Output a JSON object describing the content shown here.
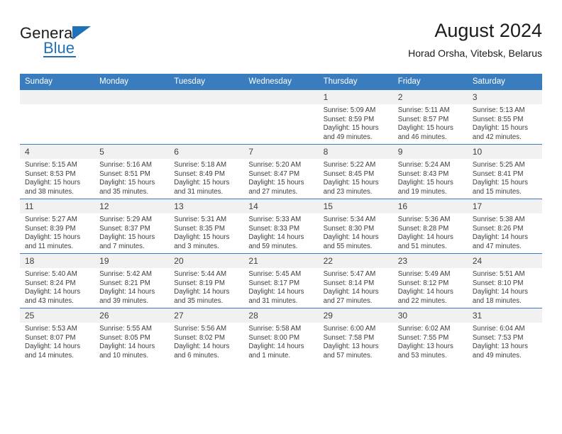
{
  "brand": {
    "name_top": "General",
    "name_bottom": "Blue",
    "accent_color": "#2072b8"
  },
  "header": {
    "title": "August 2024",
    "subtitle": "Horad Orsha, Vitebsk, Belarus",
    "header_bg_color": "#3a7dbf",
    "daynum_bg_color": "#f1f1f1"
  },
  "weekdays": [
    "Sunday",
    "Monday",
    "Tuesday",
    "Wednesday",
    "Thursday",
    "Friday",
    "Saturday"
  ],
  "labels": {
    "sunrise": "Sunrise:",
    "sunset": "Sunset:",
    "daylight": "Daylight:"
  },
  "weeks": [
    [
      {
        "day": "",
        "blank": true
      },
      {
        "day": "",
        "blank": true
      },
      {
        "day": "",
        "blank": true
      },
      {
        "day": "",
        "blank": true
      },
      {
        "day": "1",
        "sunrise": "Sunrise: 5:09 AM",
        "sunset": "Sunset: 8:59 PM",
        "daylight": "Daylight: 15 hours and 49 minutes."
      },
      {
        "day": "2",
        "sunrise": "Sunrise: 5:11 AM",
        "sunset": "Sunset: 8:57 PM",
        "daylight": "Daylight: 15 hours and 46 minutes."
      },
      {
        "day": "3",
        "sunrise": "Sunrise: 5:13 AM",
        "sunset": "Sunset: 8:55 PM",
        "daylight": "Daylight: 15 hours and 42 minutes."
      }
    ],
    [
      {
        "day": "4",
        "sunrise": "Sunrise: 5:15 AM",
        "sunset": "Sunset: 8:53 PM",
        "daylight": "Daylight: 15 hours and 38 minutes."
      },
      {
        "day": "5",
        "sunrise": "Sunrise: 5:16 AM",
        "sunset": "Sunset: 8:51 PM",
        "daylight": "Daylight: 15 hours and 35 minutes."
      },
      {
        "day": "6",
        "sunrise": "Sunrise: 5:18 AM",
        "sunset": "Sunset: 8:49 PM",
        "daylight": "Daylight: 15 hours and 31 minutes."
      },
      {
        "day": "7",
        "sunrise": "Sunrise: 5:20 AM",
        "sunset": "Sunset: 8:47 PM",
        "daylight": "Daylight: 15 hours and 27 minutes."
      },
      {
        "day": "8",
        "sunrise": "Sunrise: 5:22 AM",
        "sunset": "Sunset: 8:45 PM",
        "daylight": "Daylight: 15 hours and 23 minutes."
      },
      {
        "day": "9",
        "sunrise": "Sunrise: 5:24 AM",
        "sunset": "Sunset: 8:43 PM",
        "daylight": "Daylight: 15 hours and 19 minutes."
      },
      {
        "day": "10",
        "sunrise": "Sunrise: 5:25 AM",
        "sunset": "Sunset: 8:41 PM",
        "daylight": "Daylight: 15 hours and 15 minutes."
      }
    ],
    [
      {
        "day": "11",
        "sunrise": "Sunrise: 5:27 AM",
        "sunset": "Sunset: 8:39 PM",
        "daylight": "Daylight: 15 hours and 11 minutes."
      },
      {
        "day": "12",
        "sunrise": "Sunrise: 5:29 AM",
        "sunset": "Sunset: 8:37 PM",
        "daylight": "Daylight: 15 hours and 7 minutes."
      },
      {
        "day": "13",
        "sunrise": "Sunrise: 5:31 AM",
        "sunset": "Sunset: 8:35 PM",
        "daylight": "Daylight: 15 hours and 3 minutes."
      },
      {
        "day": "14",
        "sunrise": "Sunrise: 5:33 AM",
        "sunset": "Sunset: 8:33 PM",
        "daylight": "Daylight: 14 hours and 59 minutes."
      },
      {
        "day": "15",
        "sunrise": "Sunrise: 5:34 AM",
        "sunset": "Sunset: 8:30 PM",
        "daylight": "Daylight: 14 hours and 55 minutes."
      },
      {
        "day": "16",
        "sunrise": "Sunrise: 5:36 AM",
        "sunset": "Sunset: 8:28 PM",
        "daylight": "Daylight: 14 hours and 51 minutes."
      },
      {
        "day": "17",
        "sunrise": "Sunrise: 5:38 AM",
        "sunset": "Sunset: 8:26 PM",
        "daylight": "Daylight: 14 hours and 47 minutes."
      }
    ],
    [
      {
        "day": "18",
        "sunrise": "Sunrise: 5:40 AM",
        "sunset": "Sunset: 8:24 PM",
        "daylight": "Daylight: 14 hours and 43 minutes."
      },
      {
        "day": "19",
        "sunrise": "Sunrise: 5:42 AM",
        "sunset": "Sunset: 8:21 PM",
        "daylight": "Daylight: 14 hours and 39 minutes."
      },
      {
        "day": "20",
        "sunrise": "Sunrise: 5:44 AM",
        "sunset": "Sunset: 8:19 PM",
        "daylight": "Daylight: 14 hours and 35 minutes."
      },
      {
        "day": "21",
        "sunrise": "Sunrise: 5:45 AM",
        "sunset": "Sunset: 8:17 PM",
        "daylight": "Daylight: 14 hours and 31 minutes."
      },
      {
        "day": "22",
        "sunrise": "Sunrise: 5:47 AM",
        "sunset": "Sunset: 8:14 PM",
        "daylight": "Daylight: 14 hours and 27 minutes."
      },
      {
        "day": "23",
        "sunrise": "Sunrise: 5:49 AM",
        "sunset": "Sunset: 8:12 PM",
        "daylight": "Daylight: 14 hours and 22 minutes."
      },
      {
        "day": "24",
        "sunrise": "Sunrise: 5:51 AM",
        "sunset": "Sunset: 8:10 PM",
        "daylight": "Daylight: 14 hours and 18 minutes."
      }
    ],
    [
      {
        "day": "25",
        "sunrise": "Sunrise: 5:53 AM",
        "sunset": "Sunset: 8:07 PM",
        "daylight": "Daylight: 14 hours and 14 minutes."
      },
      {
        "day": "26",
        "sunrise": "Sunrise: 5:55 AM",
        "sunset": "Sunset: 8:05 PM",
        "daylight": "Daylight: 14 hours and 10 minutes."
      },
      {
        "day": "27",
        "sunrise": "Sunrise: 5:56 AM",
        "sunset": "Sunset: 8:02 PM",
        "daylight": "Daylight: 14 hours and 6 minutes."
      },
      {
        "day": "28",
        "sunrise": "Sunrise: 5:58 AM",
        "sunset": "Sunset: 8:00 PM",
        "daylight": "Daylight: 14 hours and 1 minute."
      },
      {
        "day": "29",
        "sunrise": "Sunrise: 6:00 AM",
        "sunset": "Sunset: 7:58 PM",
        "daylight": "Daylight: 13 hours and 57 minutes."
      },
      {
        "day": "30",
        "sunrise": "Sunrise: 6:02 AM",
        "sunset": "Sunset: 7:55 PM",
        "daylight": "Daylight: 13 hours and 53 minutes."
      },
      {
        "day": "31",
        "sunrise": "Sunrise: 6:04 AM",
        "sunset": "Sunset: 7:53 PM",
        "daylight": "Daylight: 13 hours and 49 minutes."
      }
    ]
  ]
}
